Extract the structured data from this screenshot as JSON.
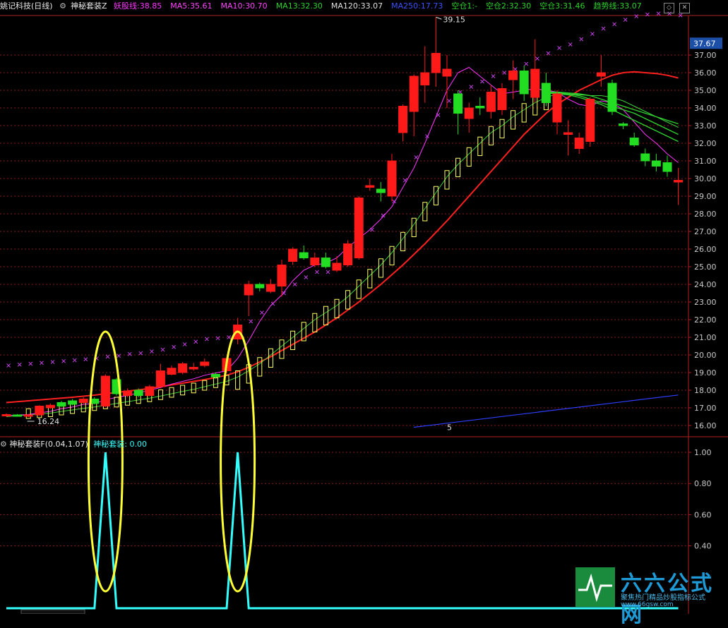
{
  "header": {
    "stock_name": "姚记科技",
    "period": "(日线)",
    "indicator_name": "神秘套装Z",
    "items": [
      {
        "label": "妖股线:",
        "value": "38.85",
        "color": "#ff33ff"
      },
      {
        "label": "MA5:",
        "value": "35.61",
        "color": "#ff44ff"
      },
      {
        "label": "MA10:",
        "value": "30.70",
        "color": "#ff44ff"
      },
      {
        "label": "MA13:",
        "value": "32.30",
        "color": "#2ed12e"
      },
      {
        "label": "MA120:",
        "value": "33.07",
        "color": "#e0e0e0"
      },
      {
        "label": "MA250:",
        "value": "17.73",
        "color": "#3a52ff"
      },
      {
        "label": "空仓1:",
        "value": "-",
        "color": "#2ed12e"
      },
      {
        "label": "空仓2:",
        "value": "32.30",
        "color": "#2ed12e"
      },
      {
        "label": "空仓3:",
        "value": "31.46",
        "color": "#2ed12e"
      },
      {
        "label": "趋势线:",
        "value": "33.07",
        "color": "#2ed12e"
      }
    ]
  },
  "sub_header": {
    "indicator": "神秘套装F",
    "params": "(0.04,1.07)",
    "value_label": "神秘套装:",
    "value": "0.00"
  },
  "annotations": {
    "high_label": "39.15",
    "low_label": "16.24",
    "current_price": "37.67",
    "five_label": "5"
  },
  "watermark": {
    "title": "六六公式网",
    "subtitle": "聚焦热门精品炒股指标公式",
    "url": "www.66gsw.com"
  },
  "colors": {
    "up": "#ff1a1a",
    "down": "#22dd22",
    "ma_red": "#ff2020",
    "ma_blue": "#2f3fff",
    "signal": "#33ffff",
    "ellipse": "#ffff33",
    "grid": "#8a1e1e"
  },
  "chart_data": [
    {
      "type": "candlestick",
      "title": "姚记科技 (日线)",
      "ylim": [
        15.5,
        39.5
      ],
      "y_ticks": [
        "16.00",
        "17.00",
        "18.00",
        "19.00",
        "20.00",
        "21.00",
        "22.00",
        "23.00",
        "24.00",
        "25.00",
        "26.00",
        "27.00",
        "28.00",
        "29.00",
        "30.00",
        "31.00",
        "32.00",
        "33.00",
        "34.00",
        "35.00",
        "36.00",
        "37.00"
      ],
      "candles": [
        [
          16.55,
          16.62,
          16.5,
          16.68
        ],
        [
          16.6,
          16.55,
          16.5,
          16.65
        ],
        [
          16.55,
          16.6,
          16.48,
          16.66
        ],
        [
          16.6,
          17.1,
          16.55,
          17.15
        ],
        [
          17.0,
          17.15,
          16.95,
          17.25
        ],
        [
          17.3,
          17.1,
          17.05,
          17.4
        ],
        [
          17.4,
          17.2,
          17.15,
          17.5
        ],
        [
          17.3,
          17.5,
          17.2,
          17.6
        ],
        [
          17.5,
          17.25,
          17.2,
          17.6
        ],
        [
          17.1,
          18.8,
          17.05,
          18.9
        ],
        [
          18.6,
          17.8,
          17.7,
          18.7
        ],
        [
          17.7,
          17.95,
          17.6,
          18.1
        ],
        [
          18.0,
          17.7,
          17.6,
          18.1
        ],
        [
          17.7,
          18.2,
          17.65,
          18.3
        ],
        [
          18.2,
          19.1,
          18.1,
          19.5
        ],
        [
          18.9,
          19.25,
          18.85,
          19.4
        ],
        [
          19.0,
          19.5,
          18.9,
          19.6
        ],
        [
          19.2,
          19.3,
          19.1,
          19.55
        ],
        [
          19.4,
          19.6,
          19.3,
          19.8
        ],
        [
          18.9,
          18.75,
          18.65,
          19.0
        ],
        [
          19.1,
          19.8,
          19.0,
          19.9
        ],
        [
          20.9,
          21.7,
          20.6,
          22.1
        ],
        [
          23.4,
          24.0,
          22.2,
          24.2
        ],
        [
          24.0,
          23.8,
          23.6,
          24.1
        ],
        [
          23.6,
          24.0,
          23.5,
          24.3
        ],
        [
          23.9,
          25.1,
          23.3,
          25.4
        ],
        [
          25.3,
          26.0,
          25.1,
          26.1
        ],
        [
          25.8,
          25.5,
          25.4,
          26.2
        ],
        [
          25.1,
          25.5,
          25.0,
          25.8
        ],
        [
          25.5,
          25.0,
          24.9,
          25.8
        ],
        [
          24.8,
          25.2,
          24.7,
          25.6
        ],
        [
          25.1,
          26.3,
          25.0,
          26.5
        ],
        [
          25.5,
          28.9,
          25.4,
          29.0
        ],
        [
          29.5,
          29.6,
          29.3,
          30.0
        ],
        [
          29.4,
          29.2,
          28.7,
          29.8
        ],
        [
          29.0,
          31.0,
          28.7,
          31.4
        ],
        [
          32.6,
          34.1,
          32.1,
          34.2
        ],
        [
          33.8,
          35.8,
          32.4,
          35.9
        ],
        [
          35.3,
          36.0,
          34.3,
          37.5
        ],
        [
          36.0,
          37.1,
          35.2,
          39.15
        ],
        [
          35.8,
          36.2,
          34.0,
          37.0
        ],
        [
          34.8,
          33.7,
          32.5,
          35.0
        ],
        [
          33.4,
          34.0,
          32.6,
          34.3
        ],
        [
          34.1,
          34.0,
          33.6,
          34.6
        ],
        [
          33.8,
          34.9,
          33.4,
          35.3
        ],
        [
          33.9,
          35.1,
          33.6,
          35.4
        ],
        [
          35.6,
          36.1,
          34.5,
          36.7
        ],
        [
          36.1,
          34.8,
          34.4,
          36.4
        ],
        [
          34.6,
          36.2,
          34.3,
          37.9
        ],
        [
          35.4,
          34.3,
          34.1,
          36.0
        ],
        [
          33.2,
          34.8,
          32.5,
          35.0
        ],
        [
          32.5,
          32.6,
          31.3,
          33.3
        ],
        [
          31.7,
          32.3,
          31.4,
          32.6
        ],
        [
          32.1,
          34.5,
          31.8,
          34.6
        ],
        [
          35.8,
          36.0,
          35.2,
          37.0
        ],
        [
          35.4,
          33.8,
          33.6,
          35.6
        ],
        [
          33.1,
          33.0,
          32.8,
          33.2
        ],
        [
          32.3,
          31.9,
          31.8,
          32.6
        ],
        [
          31.4,
          31.0,
          30.7,
          31.7
        ],
        [
          31.0,
          30.7,
          30.4,
          31.4
        ],
        [
          30.9,
          30.4,
          30.1,
          31.3
        ],
        [
          29.8,
          29.9,
          28.5,
          30.6
        ]
      ],
      "series": [
        {
          "name": "MA5",
          "values": [
            16.55,
            16.6,
            16.62,
            16.72,
            16.8,
            16.95,
            17.05,
            17.2,
            17.25,
            17.45,
            17.6,
            17.7,
            17.85,
            18.0,
            18.15,
            18.35,
            18.5,
            18.65,
            18.85,
            18.98,
            19.1,
            19.8,
            20.8,
            21.9,
            22.8,
            23.4,
            24.2,
            24.8,
            25.1,
            25.2,
            25.5,
            26.1,
            26.6,
            27.1,
            27.7,
            28.4,
            29.5,
            30.6,
            32.0,
            33.5,
            35.0,
            36.0,
            36.3,
            35.8,
            35.3,
            34.8,
            34.9,
            35.0,
            35.1,
            35.0,
            34.9,
            34.5,
            34.2,
            34.1,
            34.4,
            34.3,
            33.9,
            33.2,
            32.5,
            32.0,
            31.4,
            30.9
          ]
        },
        {
          "name": "MA13",
          "values": [
            16.5,
            16.55,
            16.6,
            16.65,
            16.7,
            16.8,
            16.88,
            16.97,
            17.05,
            17.15,
            17.25,
            17.35,
            17.45,
            17.55,
            17.67,
            17.8,
            17.93,
            18.05,
            18.2,
            18.35,
            18.5,
            18.75,
            19.1,
            19.5,
            20.0,
            20.5,
            21.0,
            21.5,
            22.0,
            22.4,
            22.8,
            23.3,
            23.9,
            24.5,
            25.1,
            25.8,
            26.6,
            27.4,
            28.3,
            29.2,
            30.1,
            30.8,
            31.4,
            32.0,
            32.6,
            33.0,
            33.5,
            33.9,
            34.3,
            34.6,
            34.8,
            34.8,
            34.75,
            34.7,
            34.7,
            34.6,
            34.4,
            34.1,
            33.8,
            33.5,
            33.2,
            32.9
          ]
        },
        {
          "name": "MA120",
          "values": [
            17.3,
            17.35,
            17.4,
            17.45,
            17.5,
            17.55,
            17.6,
            17.66,
            17.72,
            17.8,
            17.87,
            17.95,
            18.02,
            18.1,
            18.2,
            18.3,
            18.4,
            18.5,
            18.6,
            18.72,
            18.85,
            19.05,
            19.3,
            19.6,
            19.9,
            20.25,
            20.6,
            20.95,
            21.3,
            21.7,
            22.1,
            22.55,
            23.0,
            23.5,
            24.0,
            24.55,
            25.1,
            25.7,
            26.3,
            26.95,
            27.6,
            28.3,
            29.0,
            29.7,
            30.4,
            31.1,
            31.8,
            32.5,
            33.1,
            33.7,
            34.2,
            34.6,
            35.0,
            35.3,
            35.6,
            35.85,
            36.0,
            36.05,
            36.0,
            35.95,
            35.85,
            35.7
          ]
        },
        {
          "name": "MA250",
          "x": [
            37,
            61
          ],
          "values": [
            15.9,
            17.73
          ]
        },
        {
          "name": "妖股线",
          "values": [
            19.0,
            19.05,
            19.1,
            19.15,
            19.2,
            19.25,
            19.3,
            19.35,
            19.4,
            19.5,
            19.55,
            19.65,
            19.7,
            19.8,
            19.9,
            20.05,
            20.2,
            20.35,
            20.5,
            20.55,
            20.6,
            21.0,
            21.5,
            22.0,
            22.5,
            23.1,
            23.6,
            24.0,
            24.3,
            24.3,
            24.6,
            25.2,
            25.9,
            26.7,
            27.5,
            28.3,
            29.5,
            30.8,
            32.0,
            33.2,
            34.0,
            34.5,
            34.8,
            35.1,
            35.4,
            35.6,
            35.8,
            36.1,
            36.4,
            36.7,
            37.0,
            37.2,
            37.5,
            37.8,
            38.1,
            38.35,
            38.6,
            38.8,
            38.9,
            38.95,
            38.95,
            38.85
          ]
        }
      ]
    },
    {
      "type": "line",
      "title": "神秘套装F(0.04,1.07)",
      "ylim": [
        0,
        1.0
      ],
      "y_ticks": [
        "0.40",
        "0.60",
        "0.80",
        "1.00"
      ],
      "series": [
        {
          "name": "神秘套装",
          "values": [
            0,
            0,
            0,
            0,
            0,
            0,
            0,
            0,
            0,
            1,
            0,
            0,
            0,
            0,
            0,
            0,
            0,
            0,
            0,
            0,
            0,
            1,
            0,
            0,
            0,
            0,
            0,
            0,
            0,
            0,
            0,
            0,
            0,
            0,
            0,
            0,
            0,
            0,
            0,
            0,
            0,
            0,
            0,
            0,
            0,
            0,
            0,
            0,
            0,
            0,
            0,
            0,
            0,
            0,
            0,
            0,
            0,
            0,
            0,
            0,
            0,
            0
          ]
        }
      ]
    }
  ]
}
